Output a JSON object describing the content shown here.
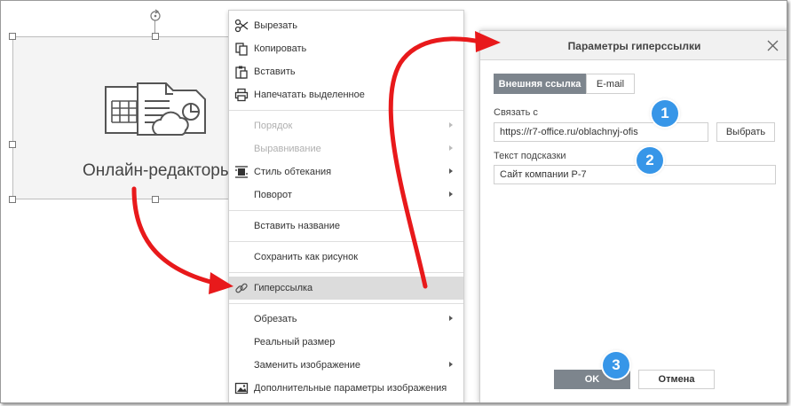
{
  "image_object": {
    "caption": "Онлайн-редакторы"
  },
  "context_menu": {
    "items": [
      {
        "label": "Вырезать",
        "icon": "scissors-icon",
        "disabled": false,
        "submenu": false
      },
      {
        "label": "Копировать",
        "icon": "copy-icon",
        "disabled": false,
        "submenu": false
      },
      {
        "label": "Вставить",
        "icon": "paste-icon",
        "disabled": false,
        "submenu": false
      },
      {
        "label": "Напечатать выделенное",
        "icon": "print-icon",
        "disabled": false,
        "submenu": false
      },
      {
        "label": "Порядок",
        "icon": "",
        "disabled": true,
        "submenu": true
      },
      {
        "label": "Выравнивание",
        "icon": "",
        "disabled": true,
        "submenu": true
      },
      {
        "label": "Стиль обтекания",
        "icon": "wrap-style-icon",
        "disabled": false,
        "submenu": true
      },
      {
        "label": "Поворот",
        "icon": "",
        "disabled": false,
        "submenu": true
      },
      {
        "label": "Вставить название",
        "icon": "",
        "disabled": false,
        "submenu": false
      },
      {
        "label": "Сохранить как рисунок",
        "icon": "",
        "disabled": false,
        "submenu": false
      },
      {
        "label": "Гиперссылка",
        "icon": "link-icon",
        "disabled": false,
        "submenu": false,
        "highlighted": true
      },
      {
        "label": "Обрезать",
        "icon": "",
        "disabled": false,
        "submenu": true
      },
      {
        "label": "Реальный размер",
        "icon": "",
        "disabled": false,
        "submenu": false
      },
      {
        "label": "Заменить изображение",
        "icon": "",
        "disabled": false,
        "submenu": true
      },
      {
        "label": "Дополнительные параметры изображения",
        "icon": "image-icon",
        "disabled": false,
        "submenu": false
      }
    ]
  },
  "dialog": {
    "title": "Параметры гиперссылки",
    "tabs": {
      "external": "Внешняя ссылка",
      "email": "E-mail"
    },
    "link_label": "Связать с",
    "link_value": "https://r7-office.ru/oblachnyj-ofis",
    "browse_button": "Выбрать",
    "tooltip_label": "Текст подсказки",
    "tooltip_value": "Сайт компании Р-7",
    "ok_button": "OK",
    "cancel_button": "Отмена"
  },
  "badges": [
    "1",
    "2",
    "3"
  ],
  "colors": {
    "arrow": "#e8191b",
    "badge": "#3796e8",
    "primary_button": "#7d858d"
  }
}
